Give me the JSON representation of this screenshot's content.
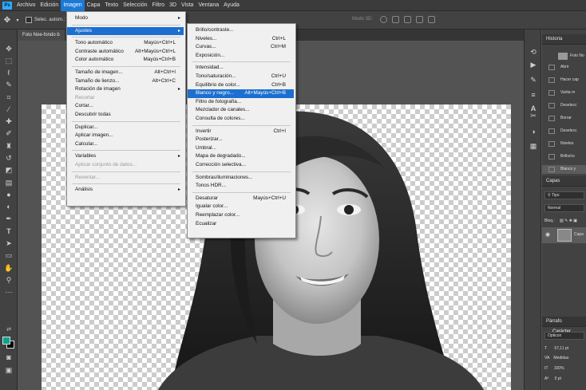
{
  "menubar": {
    "logo": "Ps",
    "items": [
      "Archivo",
      "Edición",
      "Imagen",
      "Capa",
      "Texto",
      "Selección",
      "Filtro",
      "3D",
      "Vista",
      "Ventana",
      "Ayuda"
    ],
    "active_index": 2
  },
  "options_bar": {
    "auto_select_label": "Selec. autom.:",
    "mode_3d_label": "Modo 3D:"
  },
  "document_tab": {
    "title": "Foto Noe-fondo b"
  },
  "image_menu": {
    "items": [
      {
        "label": "Modo",
        "shortcut": "",
        "submenu": true
      },
      {
        "sep": true
      },
      {
        "label": "Ajustes",
        "shortcut": "",
        "submenu": true,
        "highlight": true
      },
      {
        "sep": true
      },
      {
        "label": "Tono automático",
        "shortcut": "Mayús+Ctrl+L"
      },
      {
        "label": "Contraste automático",
        "shortcut": "Alt+Mayús+Ctrl+L"
      },
      {
        "label": "Color automático",
        "shortcut": "Mayús+Ctrl+B"
      },
      {
        "sep": true
      },
      {
        "label": "Tamaño de imagen...",
        "shortcut": "Alt+Ctrl+I"
      },
      {
        "label": "Tamaño de lienzo...",
        "shortcut": "Alt+Ctrl+C"
      },
      {
        "label": "Rotación de imagen",
        "shortcut": "",
        "submenu": true
      },
      {
        "label": "Recortar",
        "shortcut": "",
        "disabled": true
      },
      {
        "label": "Cortar...",
        "shortcut": ""
      },
      {
        "label": "Descubrir todas",
        "shortcut": ""
      },
      {
        "sep": true
      },
      {
        "label": "Duplicar...",
        "shortcut": ""
      },
      {
        "label": "Aplicar imagen...",
        "shortcut": ""
      },
      {
        "label": "Calcular...",
        "shortcut": ""
      },
      {
        "sep": true
      },
      {
        "label": "Variables",
        "shortcut": "",
        "submenu": true
      },
      {
        "label": "Aplicar conjunto de datos...",
        "shortcut": "",
        "disabled": true
      },
      {
        "sep": true
      },
      {
        "label": "Reventar...",
        "shortcut": "",
        "disabled": true
      },
      {
        "sep": true
      },
      {
        "label": "Análisis",
        "shortcut": "",
        "submenu": true
      }
    ]
  },
  "ajustes_menu": {
    "items": [
      {
        "label": "Brillo/contraste...",
        "shortcut": ""
      },
      {
        "label": "Niveles...",
        "shortcut": "Ctrl+L"
      },
      {
        "label": "Curvas...",
        "shortcut": "Ctrl+M"
      },
      {
        "label": "Exposición...",
        "shortcut": ""
      },
      {
        "sep": true
      },
      {
        "label": "Intensidad...",
        "shortcut": ""
      },
      {
        "label": "Tono/saturación...",
        "shortcut": "Ctrl+U"
      },
      {
        "label": "Equilibrio de color...",
        "shortcut": "Ctrl+B"
      },
      {
        "label": "Blanco y negro...",
        "shortcut": "Alt+Mayús+Ctrl+B",
        "highlight": true
      },
      {
        "label": "Filtro de fotografía...",
        "shortcut": ""
      },
      {
        "label": "Mezclador de canales...",
        "shortcut": ""
      },
      {
        "label": "Consulta de colores...",
        "shortcut": ""
      },
      {
        "sep": true
      },
      {
        "label": "Invertir",
        "shortcut": "Ctrl+I"
      },
      {
        "label": "Posterizar...",
        "shortcut": ""
      },
      {
        "label": "Umbral...",
        "shortcut": ""
      },
      {
        "label": "Mapa de degradado...",
        "shortcut": ""
      },
      {
        "label": "Corrección selectiva...",
        "shortcut": ""
      },
      {
        "sep": true
      },
      {
        "label": "Sombras/iluminaciones...",
        "shortcut": ""
      },
      {
        "label": "Tonos HDR...",
        "shortcut": ""
      },
      {
        "sep": true
      },
      {
        "label": "Desaturar",
        "shortcut": "Mayús+Ctrl+U"
      },
      {
        "label": "Igualar color...",
        "shortcut": ""
      },
      {
        "label": "Reemplazar color...",
        "shortcut": ""
      },
      {
        "label": "Ecualizar",
        "shortcut": ""
      }
    ]
  },
  "history_panel": {
    "title": "Historia",
    "snapshot": "Foto No",
    "items": [
      "Abrir",
      "Hacer cap",
      "Varita m",
      "Deselecc",
      "Borrar",
      "Deselecc",
      "Niveles",
      "Brillo/co",
      "Blanco y"
    ],
    "selected_index": 8
  },
  "layers_panel": {
    "title": "Capas",
    "filter_label": "Tipo",
    "blend_mode": "Normal",
    "lock_label": "Bloq.:",
    "layer_name": "Capa"
  },
  "character_panel": {
    "tabs": [
      "Párrafo",
      "Carácter"
    ],
    "font": "Opticon",
    "size": "57,11 pt",
    "kerning": "Medidas",
    "scale": "100%",
    "baseline": "0 pt"
  },
  "colors": {
    "foreground": "#0aa58e",
    "background": "#000000",
    "highlight": "#1c6fd0"
  }
}
